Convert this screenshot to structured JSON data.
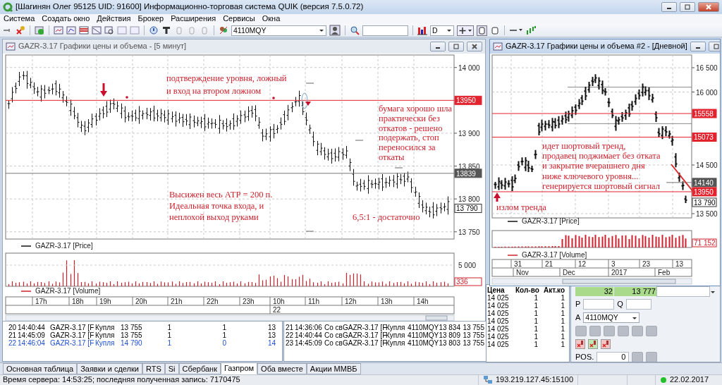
{
  "window": {
    "title": "[Шагинян Олег 95125 UID: 91600] Информационно-торговая система QUIK (версия 7.5.0.72)",
    "active": true
  },
  "menu": [
    "Система",
    "Создать окно",
    "Действия",
    "Брокер",
    "Расширения",
    "Сервисы",
    "Окна"
  ],
  "toolbar": {
    "account": "4110MQY",
    "interval": "D"
  },
  "charts": [
    {
      "title": "GAZR-3.17 Графики цены и объема - [5 минут]",
      "active": false,
      "y_ticks": [
        "14 000",
        "13 900",
        "13 850",
        "13 800",
        "13 750"
      ],
      "levels": [
        {
          "kind": "level",
          "label": "13950"
        },
        {
          "kind": "line",
          "label": "13839"
        },
        {
          "kind": "last",
          "label": "13 790"
        }
      ],
      "price_legend": "GAZR-3.17 [Price]",
      "volume_ticks": [
        "5 000"
      ],
      "volume_label": "336",
      "volume_legend": "GAZR-3.17 [Volume]",
      "time_labels": [
        "17h",
        "18h",
        "19h",
        "20h",
        "21h",
        "22h",
        "23h",
        "10h",
        "11h",
        "12h",
        "13h",
        "14h"
      ],
      "date_labels": [
        "22"
      ],
      "annotations": [
        {
          "lines": [
            "подтверждение уровня, ложный",
            "и вход на втором ложном"
          ]
        },
        {
          "lines": [
            "бумага хорошо шла",
            "практически без",
            "откатов - решено",
            "подержать, стоп",
            "переносился за",
            "откаты"
          ]
        },
        {
          "lines": [
            "Высижен весь АТР = 200 п.",
            "Идеальная точка входа, и",
            "неплохой выход руками"
          ]
        },
        {
          "lines": [
            "6,5:1 - достаточно"
          ]
        }
      ]
    },
    {
      "title": "GAZR-3.17 Графики цены и объема #2 - [Дневной]",
      "active": true,
      "y_ticks": [
        "16 500",
        "16 000",
        "14 500",
        "13 500"
      ],
      "levels": [
        {
          "kind": "level",
          "label": "15558"
        },
        {
          "kind": "level",
          "label": "15073"
        },
        {
          "kind": "line",
          "label": "14140"
        },
        {
          "kind": "level",
          "label": "13950"
        },
        {
          "kind": "last",
          "label": "13 790"
        }
      ],
      "price_legend": "GAZR-3.17 [Price]",
      "volume_label": "71 152",
      "volume_legend": "GAZR-3.17 [Volume]",
      "time_labels": [
        "31",
        "21",
        "12",
        "3",
        "23",
        "13"
      ],
      "date_labels": [
        "Nov",
        "Dec",
        "2017",
        "Feb"
      ],
      "annotations": [
        {
          "lines": [
            "идет шортовый тренд,",
            "продавец поджимает без отката",
            "и закрытие вчерашнего дня",
            "ниже ключевого уровня...",
            "генерируется шортовый сигнал"
          ]
        },
        {
          "lines": [
            "излом тренда"
          ]
        }
      ]
    }
  ],
  "trades_table": {
    "rows": [
      {
        "cells": [
          "20",
          "14:40:44",
          "GAZR-3.17 [F",
          "Купля",
          "13 755",
          "1",
          "1",
          "13"
        ],
        "color": "#000000"
      },
      {
        "cells": [
          "21",
          "14:45:09",
          "GAZR-3.17 [F",
          "Купля",
          "13 755",
          "1",
          "1",
          "13"
        ],
        "color": "#000000"
      },
      {
        "cells": [
          "22",
          "14:46:04",
          "GAZR-3.17 [F",
          "Купля",
          "14 790",
          "1",
          "0",
          "14"
        ],
        "color": "#1f4fd0"
      }
    ]
  },
  "orders_table": {
    "rows": [
      {
        "cells": [
          "21",
          "14:36:06",
          "Со св",
          "GAZR-3.17 [F",
          "Купля",
          "4110MQY",
          "13 834",
          "13 755"
        ]
      },
      {
        "cells": [
          "22",
          "14:40:44",
          "Со св",
          "GAZR-3.17 [F",
          "Купля",
          "4110MQY",
          "13 809",
          "13 755"
        ]
      },
      {
        "cells": [
          "23",
          "14:45:09",
          "Со св",
          "GAZR-3.17 [F",
          "Купля",
          "4110MQY",
          "13 803",
          "13 755"
        ]
      }
    ]
  },
  "order_book": {
    "columns": [
      "Цена",
      "Кол-во",
      "Акт.ко"
    ],
    "rows": [
      [
        "14 025",
        "1",
        "1"
      ],
      [
        "14 025",
        "1",
        "1"
      ],
      [
        "14 025",
        "1",
        "1"
      ],
      [
        "14 025",
        "1",
        "1"
      ],
      [
        "14 025",
        "1",
        "1"
      ],
      [
        "14 025",
        "1",
        "1"
      ],
      [
        "14 025",
        "1",
        "1"
      ]
    ]
  },
  "order_panel": {
    "quantity": "32",
    "price": "13 777",
    "p_label": "P",
    "q_label": "Q",
    "a_label": "A",
    "account": "4110MQY",
    "pos_label": "POS.",
    "pos_value": "0"
  },
  "tabs": [
    {
      "label": "Основная таблица",
      "selected": false
    },
    {
      "label": "Заявки и сделки",
      "selected": false
    },
    {
      "label": "RTS",
      "selected": false
    },
    {
      "label": "Si",
      "selected": false
    },
    {
      "label": "Сбербанк",
      "selected": false
    },
    {
      "label": "Газпром",
      "selected": true
    },
    {
      "label": "Оба вместе",
      "selected": false
    },
    {
      "label": "Акции ММВБ",
      "selected": false
    }
  ],
  "status_bar": {
    "server_text": "Время сервера: 14:53:25; последняя полученная запись: 7170475",
    "address": "193.219.127.45:15100",
    "date": "22.02.2017",
    "connected": true
  }
}
